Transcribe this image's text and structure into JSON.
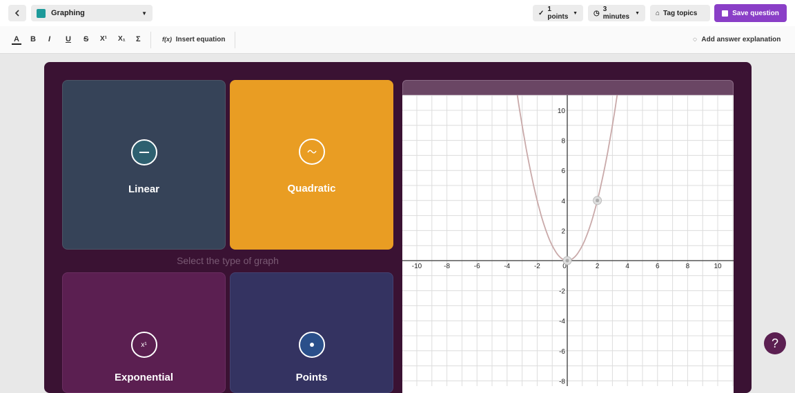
{
  "header": {
    "question_type": "Graphing",
    "points": "1 points",
    "time": "3 minutes",
    "tag_topics": "Tag topics",
    "save": "Save question"
  },
  "toolbar": {
    "text_color": "A",
    "bold": "B",
    "italic": "I",
    "underline": "U",
    "strike": "S",
    "superscript": "X¹",
    "subscript": "X₁",
    "sigma": "Σ",
    "insert_equation_icon": "f(x)",
    "insert_equation": "Insert equation",
    "add_explanation": "Add answer explanation"
  },
  "graph_types": {
    "prompt": "Select the type of graph",
    "cards": [
      {
        "label": "Linear",
        "icon": "line-icon",
        "color": "#364358"
      },
      {
        "label": "Quadratic",
        "icon": "wave-icon",
        "color": "#e99d23"
      },
      {
        "label": "Exponential",
        "icon": "x-power-icon",
        "icon_text": "x¹",
        "color": "#5b1f51"
      },
      {
        "label": "Points",
        "icon": "dot-icon",
        "color": "#343361"
      }
    ]
  },
  "graph": {
    "x_ticks": [
      "-10",
      "-8",
      "-6",
      "-4",
      "-2",
      "0",
      "2",
      "4",
      "6",
      "8",
      "10"
    ],
    "y_ticks": [
      "10",
      "8",
      "6",
      "4",
      "2",
      "-2",
      "-4",
      "-6",
      "-8"
    ],
    "xlim": [
      -11,
      11
    ],
    "ylim": [
      -8.5,
      11
    ],
    "curve": "y = x^2",
    "points": [
      {
        "x": 0,
        "y": 0
      },
      {
        "x": 2,
        "y": 4
      }
    ]
  },
  "help": "?",
  "colors": {
    "accent": "#8a3fc7",
    "panel": "#3a1233"
  }
}
